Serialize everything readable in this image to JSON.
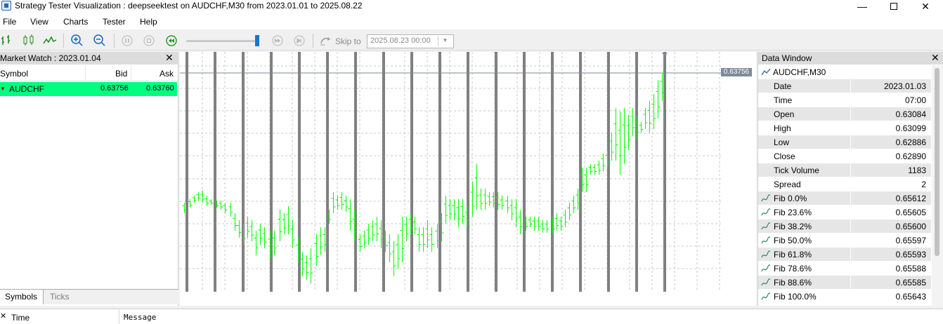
{
  "window": {
    "title": "Strategy Tester Visualization : deepseektest on AUDCHF,M30 from 2023.01.01 to 2025.08.22",
    "minimize": "—",
    "close": "✕"
  },
  "menu": {
    "items": [
      "File",
      "View",
      "Charts",
      "Tester",
      "Help"
    ]
  },
  "toolbar": {
    "skip_to_label": "Skip to",
    "skip_to_value": "2025.08.23 00:00",
    "speed_level": 0.97
  },
  "market_watch": {
    "title": "Market Watch : 2023.01.04",
    "close": "✕",
    "columns": {
      "symbol": "Symbol",
      "bid": "Bid",
      "ask": "Ask"
    },
    "rows": [
      {
        "symbol": "AUDCHF",
        "bid": "0.63756",
        "ask": "0.63760"
      }
    ],
    "tabs": [
      "Symbols",
      "Ticks"
    ],
    "row_color": "#00ff7f"
  },
  "chart": {
    "current_price_label": "0.63756",
    "bar_color": "#00ff00",
    "separator_color": "#808080"
  },
  "data_window": {
    "title": "Data Window",
    "close": "✕",
    "symbol": "AUDCHF,M30",
    "rows": [
      {
        "label": "Date",
        "value": "2023.01.03"
      },
      {
        "label": "Time",
        "value": "07:00"
      },
      {
        "label": "Open",
        "value": "0.63084"
      },
      {
        "label": "High",
        "value": "0.63099"
      },
      {
        "label": "Low",
        "value": "0.62886"
      },
      {
        "label": "Close",
        "value": "0.62890"
      },
      {
        "label": "Tick Volume",
        "value": "1183"
      },
      {
        "label": "Spread",
        "value": "2"
      }
    ],
    "fib_rows": [
      {
        "label": "Fib 0.0%",
        "value": "0.65612"
      },
      {
        "label": "Fib 23.6%",
        "value": "0.65605"
      },
      {
        "label": "Fib 38.2%",
        "value": "0.65600"
      },
      {
        "label": "Fib 50.0%",
        "value": "0.65597"
      },
      {
        "label": "Fib 61.8%",
        "value": "0.65593"
      },
      {
        "label": "Fib 78.6%",
        "value": "0.65588"
      },
      {
        "label": "Fib 88.6%",
        "value": "0.65585"
      },
      {
        "label": "Fib 100.0%",
        "value": "0.65643"
      }
    ]
  },
  "toolbox": {
    "close": "✕",
    "columns": {
      "time": "Time",
      "message": "Message"
    }
  }
}
